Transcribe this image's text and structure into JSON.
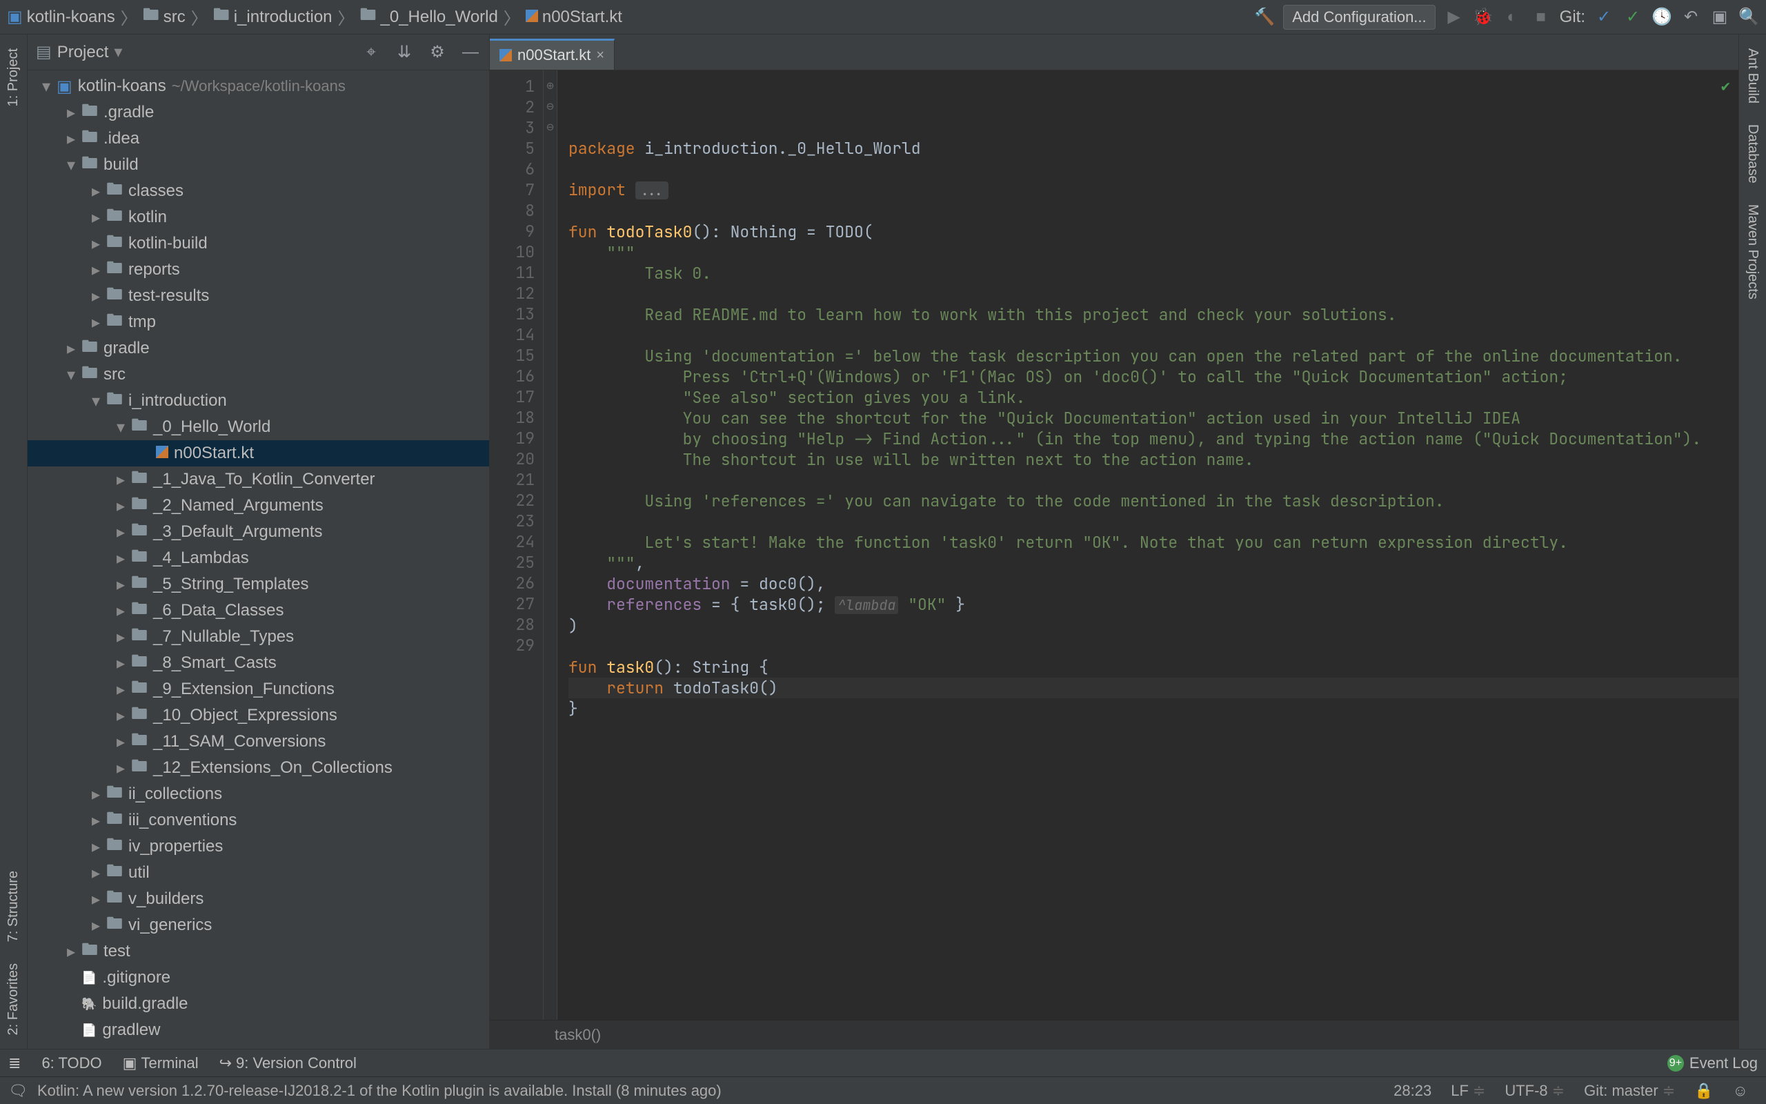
{
  "breadcrumb": [
    "kotlin-koans",
    "src",
    "i_introduction",
    "_0_Hello_World",
    "n00Start.kt"
  ],
  "nav": {
    "add_config": "Add Configuration...",
    "git_label": "Git:"
  },
  "left_tabs": [
    "1: Project"
  ],
  "left_tabs_bottom": [
    "7: Structure",
    "2: Favorites"
  ],
  "right_tabs": [
    "Ant Build",
    "Database",
    "Maven Projects"
  ],
  "project": {
    "title": "Project",
    "root": {
      "name": "kotlin-koans",
      "path": "~/Workspace/kotlin-koans"
    },
    "tree": [
      {
        "depth": 0,
        "ar": "down",
        "icon": "proj",
        "label": "kotlin-koans",
        "sub": "~/Workspace/kotlin-koans"
      },
      {
        "depth": 1,
        "ar": "right",
        "icon": "fold",
        "label": ".gradle"
      },
      {
        "depth": 1,
        "ar": "right",
        "icon": "fold",
        "label": ".idea"
      },
      {
        "depth": 1,
        "ar": "down",
        "icon": "fold",
        "label": "build"
      },
      {
        "depth": 2,
        "ar": "right",
        "icon": "fold",
        "label": "classes"
      },
      {
        "depth": 2,
        "ar": "right",
        "icon": "fold",
        "label": "kotlin"
      },
      {
        "depth": 2,
        "ar": "right",
        "icon": "fold",
        "label": "kotlin-build"
      },
      {
        "depth": 2,
        "ar": "right",
        "icon": "fold",
        "label": "reports"
      },
      {
        "depth": 2,
        "ar": "right",
        "icon": "fold",
        "label": "test-results"
      },
      {
        "depth": 2,
        "ar": "right",
        "icon": "fold",
        "label": "tmp"
      },
      {
        "depth": 1,
        "ar": "right",
        "icon": "fold",
        "label": "gradle"
      },
      {
        "depth": 1,
        "ar": "down",
        "icon": "fold",
        "label": "src"
      },
      {
        "depth": 2,
        "ar": "down",
        "icon": "fold",
        "label": "i_introduction"
      },
      {
        "depth": 3,
        "ar": "down",
        "icon": "fold",
        "label": "_0_Hello_World"
      },
      {
        "depth": 4,
        "ar": "",
        "icon": "kt",
        "label": "n00Start.kt",
        "selected": true
      },
      {
        "depth": 3,
        "ar": "right",
        "icon": "fold",
        "label": "_1_Java_To_Kotlin_Converter"
      },
      {
        "depth": 3,
        "ar": "right",
        "icon": "fold",
        "label": "_2_Named_Arguments"
      },
      {
        "depth": 3,
        "ar": "right",
        "icon": "fold",
        "label": "_3_Default_Arguments"
      },
      {
        "depth": 3,
        "ar": "right",
        "icon": "fold",
        "label": "_4_Lambdas"
      },
      {
        "depth": 3,
        "ar": "right",
        "icon": "fold",
        "label": "_5_String_Templates"
      },
      {
        "depth": 3,
        "ar": "right",
        "icon": "fold",
        "label": "_6_Data_Classes"
      },
      {
        "depth": 3,
        "ar": "right",
        "icon": "fold",
        "label": "_7_Nullable_Types"
      },
      {
        "depth": 3,
        "ar": "right",
        "icon": "fold",
        "label": "_8_Smart_Casts"
      },
      {
        "depth": 3,
        "ar": "right",
        "icon": "fold",
        "label": "_9_Extension_Functions"
      },
      {
        "depth": 3,
        "ar": "right",
        "icon": "fold",
        "label": "_10_Object_Expressions"
      },
      {
        "depth": 3,
        "ar": "right",
        "icon": "fold",
        "label": "_11_SAM_Conversions"
      },
      {
        "depth": 3,
        "ar": "right",
        "icon": "fold",
        "label": "_12_Extensions_On_Collections"
      },
      {
        "depth": 2,
        "ar": "right",
        "icon": "fold",
        "label": "ii_collections"
      },
      {
        "depth": 2,
        "ar": "right",
        "icon": "fold",
        "label": "iii_conventions"
      },
      {
        "depth": 2,
        "ar": "right",
        "icon": "fold",
        "label": "iv_properties"
      },
      {
        "depth": 2,
        "ar": "right",
        "icon": "fold",
        "label": "util"
      },
      {
        "depth": 2,
        "ar": "right",
        "icon": "fold",
        "label": "v_builders"
      },
      {
        "depth": 2,
        "ar": "right",
        "icon": "fold",
        "label": "vi_generics"
      },
      {
        "depth": 1,
        "ar": "right",
        "icon": "fold",
        "label": "test"
      },
      {
        "depth": 1,
        "ar": "",
        "icon": "file",
        "label": ".gitignore"
      },
      {
        "depth": 1,
        "ar": "",
        "icon": "gradle",
        "label": "build.gradle"
      },
      {
        "depth": 1,
        "ar": "",
        "icon": "file",
        "label": "gradlew"
      }
    ]
  },
  "editor": {
    "tab": "n00Start.kt",
    "crumb": "task0()",
    "lines": [
      {
        "n": 1,
        "frags": [
          [
            "kw",
            "package"
          ],
          [
            "",
            " i_introduction._0_Hello_World"
          ]
        ]
      },
      {
        "n": 2,
        "frags": []
      },
      {
        "n": 3,
        "frags": [
          [
            "kw",
            "import"
          ],
          [
            "",
            " "
          ],
          [
            "dots",
            "..."
          ]
        ]
      },
      {
        "n": 5,
        "frags": []
      },
      {
        "n": 6,
        "frags": [
          [
            "kw",
            "fun "
          ],
          [
            "fn",
            "todoTask0"
          ],
          [
            "",
            "(): Nothing = TODO("
          ]
        ]
      },
      {
        "n": 7,
        "frags": [
          [
            "str",
            "    \"\"\""
          ]
        ]
      },
      {
        "n": 8,
        "frags": [
          [
            "str",
            "        Task 0."
          ]
        ]
      },
      {
        "n": 9,
        "frags": []
      },
      {
        "n": 10,
        "frags": [
          [
            "str",
            "        Read README.md to learn how to work with this project and check your solutions."
          ]
        ]
      },
      {
        "n": 11,
        "frags": []
      },
      {
        "n": 12,
        "frags": [
          [
            "str",
            "        Using 'documentation =' below the task description you can open the related part of the online documentation."
          ]
        ]
      },
      {
        "n": 13,
        "frags": [
          [
            "str",
            "            Press 'Ctrl+Q'(Windows) or 'F1'(Mac OS) on 'doc0()' to call the \"Quick Documentation\" action;"
          ]
        ]
      },
      {
        "n": 14,
        "frags": [
          [
            "str",
            "            \"See also\" section gives you a link."
          ]
        ]
      },
      {
        "n": 15,
        "frags": [
          [
            "str",
            "            You can see the shortcut for the \"Quick Documentation\" action used in your IntelliJ IDEA"
          ]
        ]
      },
      {
        "n": 16,
        "frags": [
          [
            "str",
            "            by choosing \"Help -> Find Action...\" (in the top menu), and typing the action name (\"Quick Documentation\")."
          ]
        ]
      },
      {
        "n": 17,
        "frags": [
          [
            "str",
            "            The shortcut in use will be written next to the action name."
          ]
        ]
      },
      {
        "n": 18,
        "frags": []
      },
      {
        "n": 19,
        "frags": [
          [
            "str",
            "        Using 'references =' you can navigate to the code mentioned in the task description."
          ]
        ]
      },
      {
        "n": 20,
        "frags": []
      },
      {
        "n": 21,
        "frags": [
          [
            "str",
            "        Let's start! Make the function 'task0' return \"OK\". Note that you can return expression directly."
          ]
        ]
      },
      {
        "n": 22,
        "frags": [
          [
            "str",
            "    \"\"\""
          ],
          [
            "",
            ","
          ]
        ]
      },
      {
        "n": 23,
        "frags": [
          [
            "",
            "    "
          ],
          [
            "param",
            "documentation"
          ],
          [
            "",
            " = doc0(),"
          ]
        ]
      },
      {
        "n": 24,
        "frags": [
          [
            "",
            "    "
          ],
          [
            "param",
            "references"
          ],
          [
            "",
            " = { task0(); "
          ],
          [
            "inlay",
            "^lambda"
          ],
          [
            "",
            " "
          ],
          [
            "str",
            "\"OK\""
          ],
          [
            "",
            " }"
          ]
        ]
      },
      {
        "n": 25,
        "frags": [
          [
            "",
            ")"
          ]
        ]
      },
      {
        "n": 26,
        "frags": []
      },
      {
        "n": 27,
        "frags": [
          [
            "kw",
            "fun "
          ],
          [
            "fn",
            "task0"
          ],
          [
            "",
            "(): String {"
          ]
        ]
      },
      {
        "n": 28,
        "hl": true,
        "frags": [
          [
            "",
            "    "
          ],
          [
            "kw",
            "return"
          ],
          [
            "",
            " todoTask0()"
          ]
        ]
      },
      {
        "n": 29,
        "frags": [
          [
            "",
            "}"
          ]
        ]
      }
    ]
  },
  "bottom_tabs": {
    "todo": "6: TODO",
    "terminal": "Terminal",
    "vcs": "9: Version Control",
    "eventlog": "Event Log",
    "badge": "9+"
  },
  "status": {
    "message": "Kotlin: A new version 1.2.70-release-IJ2018.2-1 of the Kotlin plugin is available. Install (8 minutes ago)",
    "pos": "28:23",
    "sep": "LF",
    "enc": "UTF-8",
    "git": "Git: master"
  }
}
